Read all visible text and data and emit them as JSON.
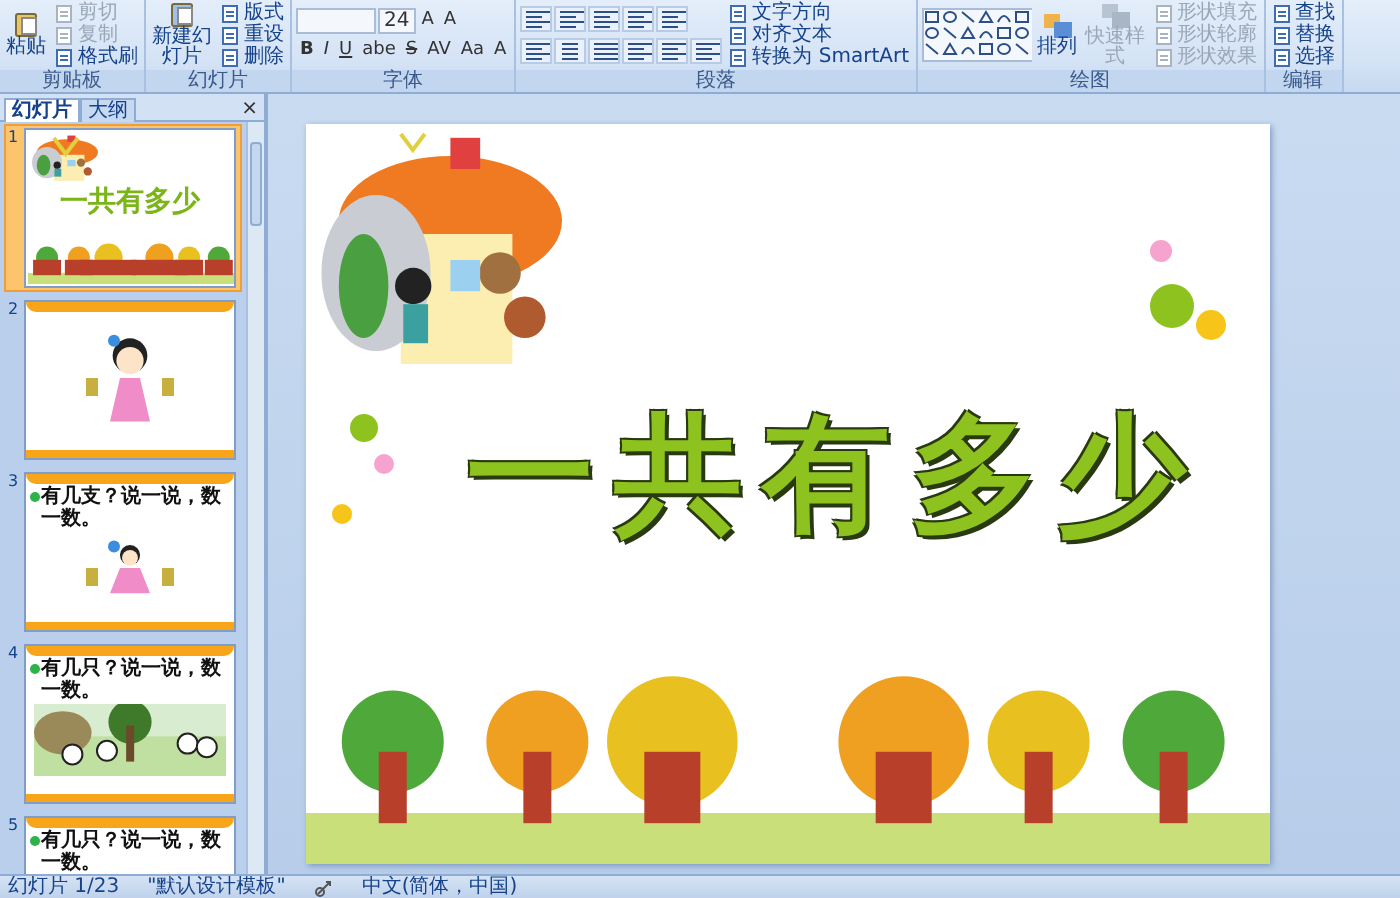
{
  "ribbon": {
    "groups": [
      {
        "kind": "standard",
        "label": "剪贴板",
        "large": [
          {
            "label": "粘贴",
            "disabled": false
          }
        ],
        "small": [
          {
            "label": "剪切",
            "disabled": true
          },
          {
            "label": "复制",
            "disabled": true
          },
          {
            "label": "格式刷",
            "disabled": false
          }
        ]
      },
      {
        "kind": "standard",
        "label": "幻灯片",
        "large": [
          {
            "label": "新建幻灯片",
            "disabled": false
          }
        ],
        "small": [
          {
            "label": "版式",
            "disabled": false
          },
          {
            "label": "重设",
            "disabled": false
          },
          {
            "label": "删除",
            "disabled": false
          }
        ]
      },
      {
        "kind": "font",
        "label": "字体",
        "size": "24",
        "buttons": [
          "A",
          "A",
          "B",
          "I",
          "U",
          "abe",
          "S",
          "AV",
          "Aa",
          "A"
        ]
      },
      {
        "kind": "paragraph",
        "label": "段落",
        "small": [
          {
            "label": "文字方向",
            "disabled": false
          },
          {
            "label": "对齐文本",
            "disabled": false
          },
          {
            "label": "转换为 SmartArt",
            "disabled": false
          }
        ]
      },
      {
        "kind": "drawing",
        "label": "绘图",
        "large": [
          {
            "label": "排列",
            "disabled": false
          },
          {
            "label": "快速样式",
            "disabled": true
          }
        ],
        "small": [
          {
            "label": "形状填充",
            "disabled": true
          },
          {
            "label": "形状轮廓",
            "disabled": true
          },
          {
            "label": "形状效果",
            "disabled": true
          }
        ]
      },
      {
        "kind": "standard",
        "label": "编辑",
        "small": [
          {
            "label": "查找",
            "disabled": false
          },
          {
            "label": "替换",
            "disabled": false
          },
          {
            "label": "选择",
            "disabled": false
          }
        ]
      }
    ]
  },
  "panel": {
    "tabs": [
      {
        "label": "幻灯片",
        "selected": true
      },
      {
        "label": "大纲",
        "selected": false
      }
    ],
    "close": "×",
    "slides": [
      {
        "number": "1",
        "kind": "title",
        "selected": true,
        "text": "一共有多少"
      },
      {
        "number": "2",
        "kind": "picture",
        "selected": false
      },
      {
        "number": "3",
        "kind": "caption",
        "selected": false,
        "text": "有几支？说一说，数一数。"
      },
      {
        "number": "4",
        "kind": "caption",
        "selected": false,
        "text": "有几只？说一说，数一数。"
      },
      {
        "number": "5",
        "kind": "caption",
        "selected": false,
        "text": "有几只？说一说，数一数。"
      }
    ]
  },
  "slide": {
    "title": "一共有多少"
  },
  "status_bar": {
    "slide": "幻灯片 1/23",
    "theme": "\"默认设计模板\"",
    "language": "中文(简体，中国)"
  }
}
